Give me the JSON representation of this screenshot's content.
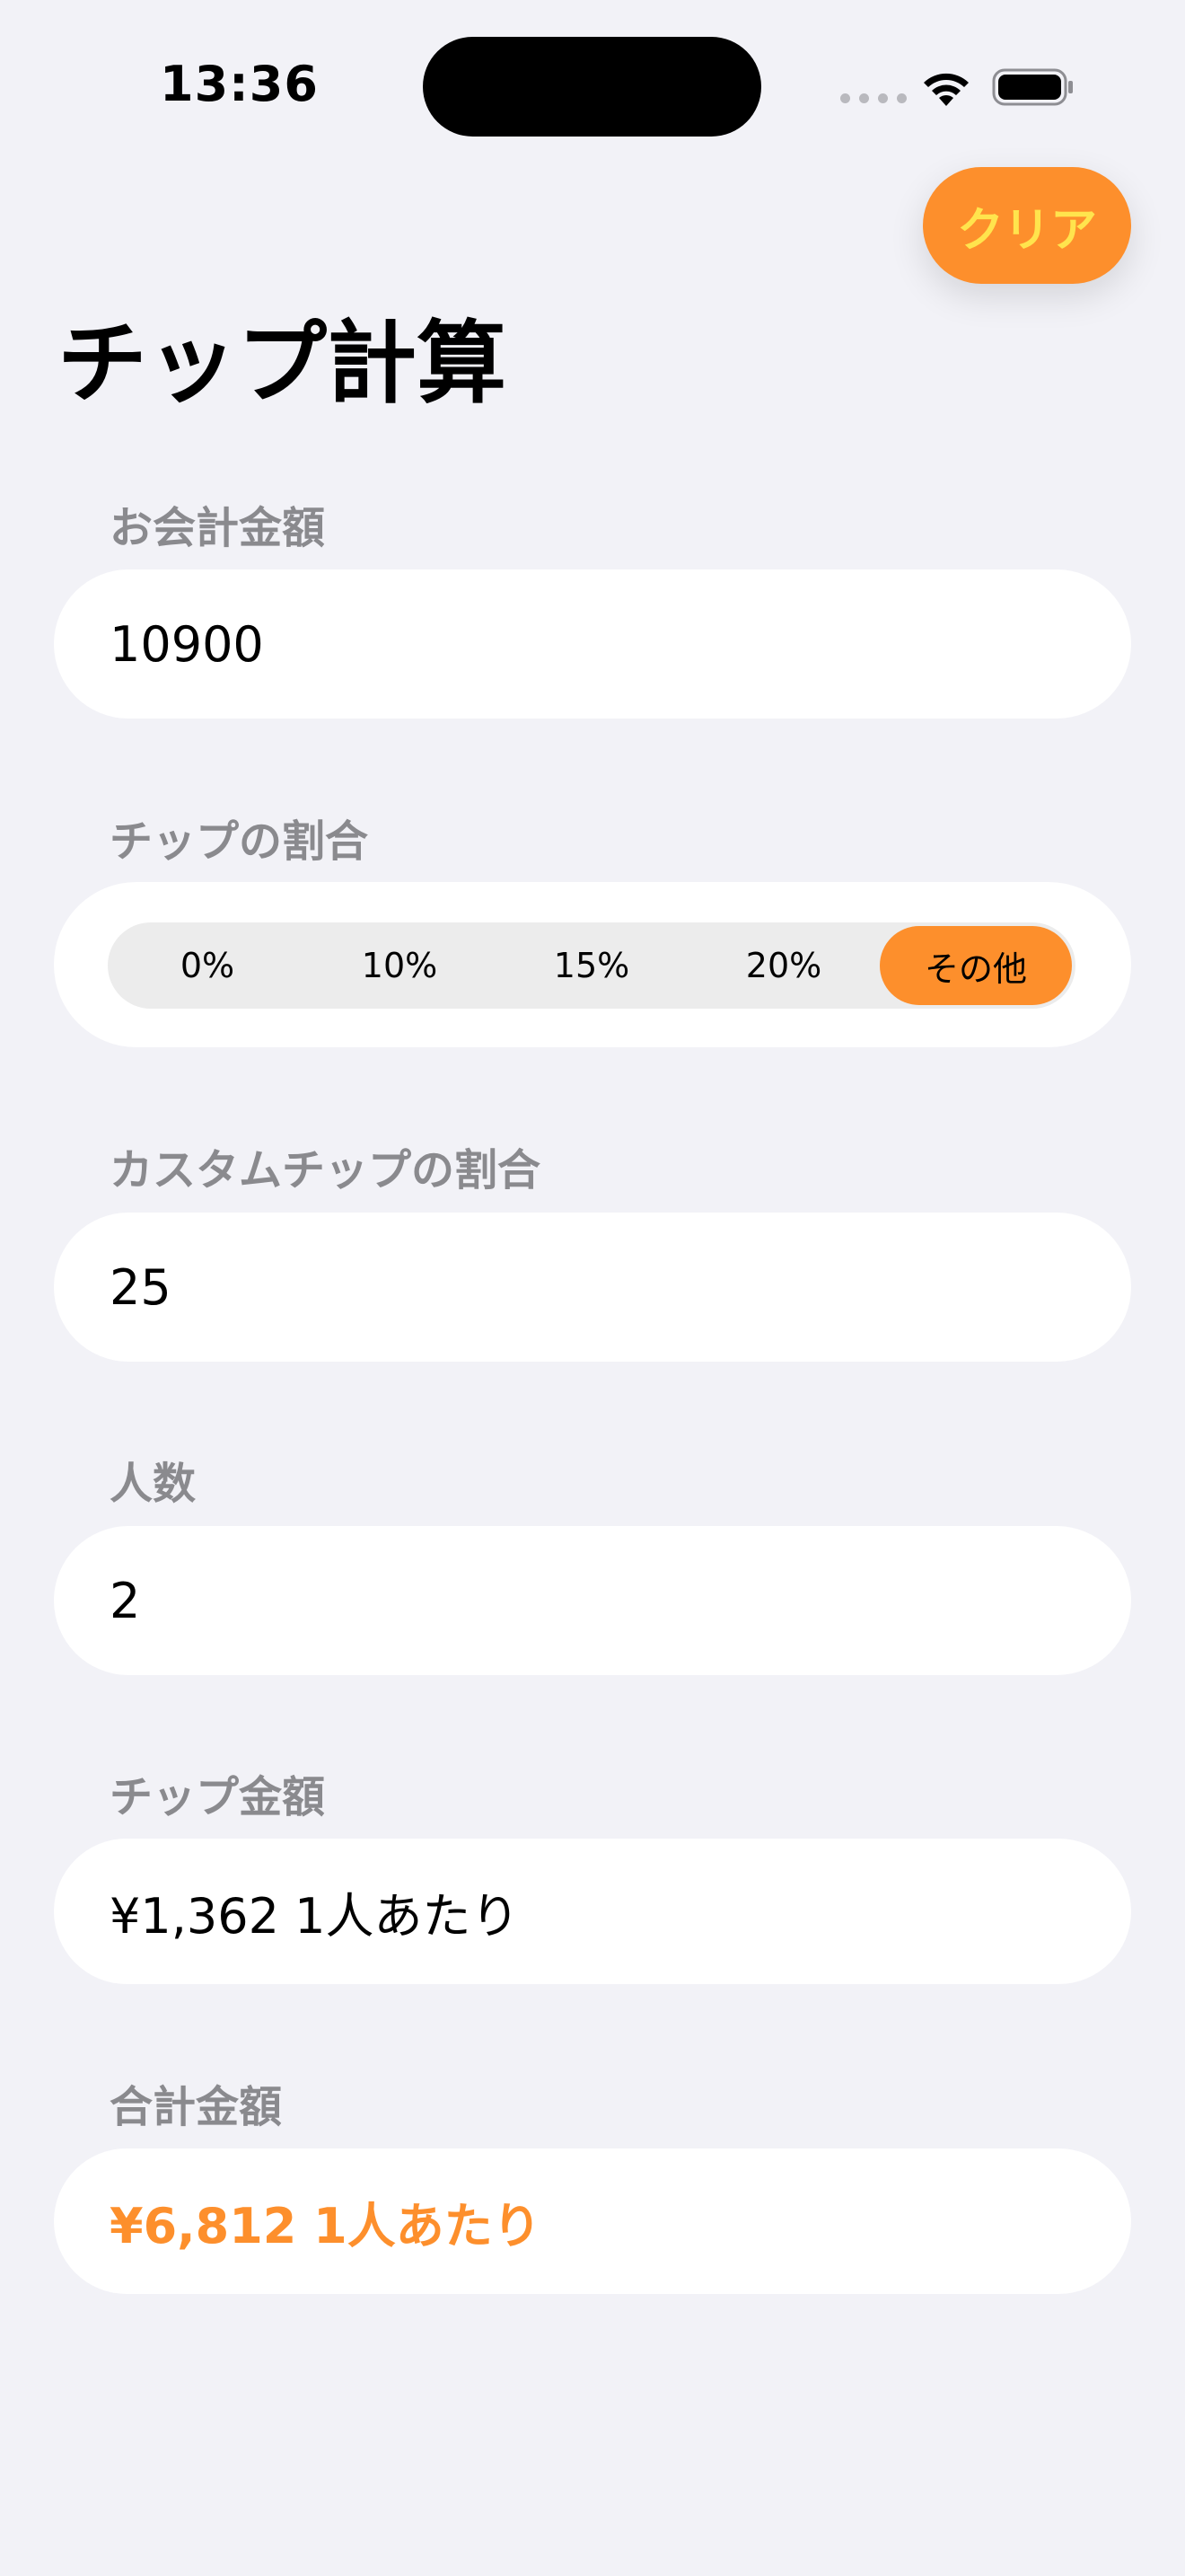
{
  "status_bar": {
    "time": "13:36"
  },
  "header": {
    "clear_label": "クリア",
    "title": "チップ計算"
  },
  "bill": {
    "label": "お会計金額",
    "value": "10900"
  },
  "tip_rate": {
    "label": "チップの割合",
    "options": [
      "0%",
      "10%",
      "15%",
      "20%",
      "その他"
    ],
    "selected": "その他"
  },
  "custom_tip": {
    "label": "カスタムチップの割合",
    "value": "25"
  },
  "people": {
    "label": "人数",
    "value": "2"
  },
  "tip_amount": {
    "label": "チップ金額",
    "value": "¥1,362 1人あたり"
  },
  "total_amount": {
    "label": "合計金額",
    "value": "¥6,812 1人あたり"
  },
  "colors": {
    "accent": "#fd8f2c",
    "clear_text": "#ffe44d",
    "background": "#f2f2f7",
    "label_gray": "#8a8a8e"
  }
}
